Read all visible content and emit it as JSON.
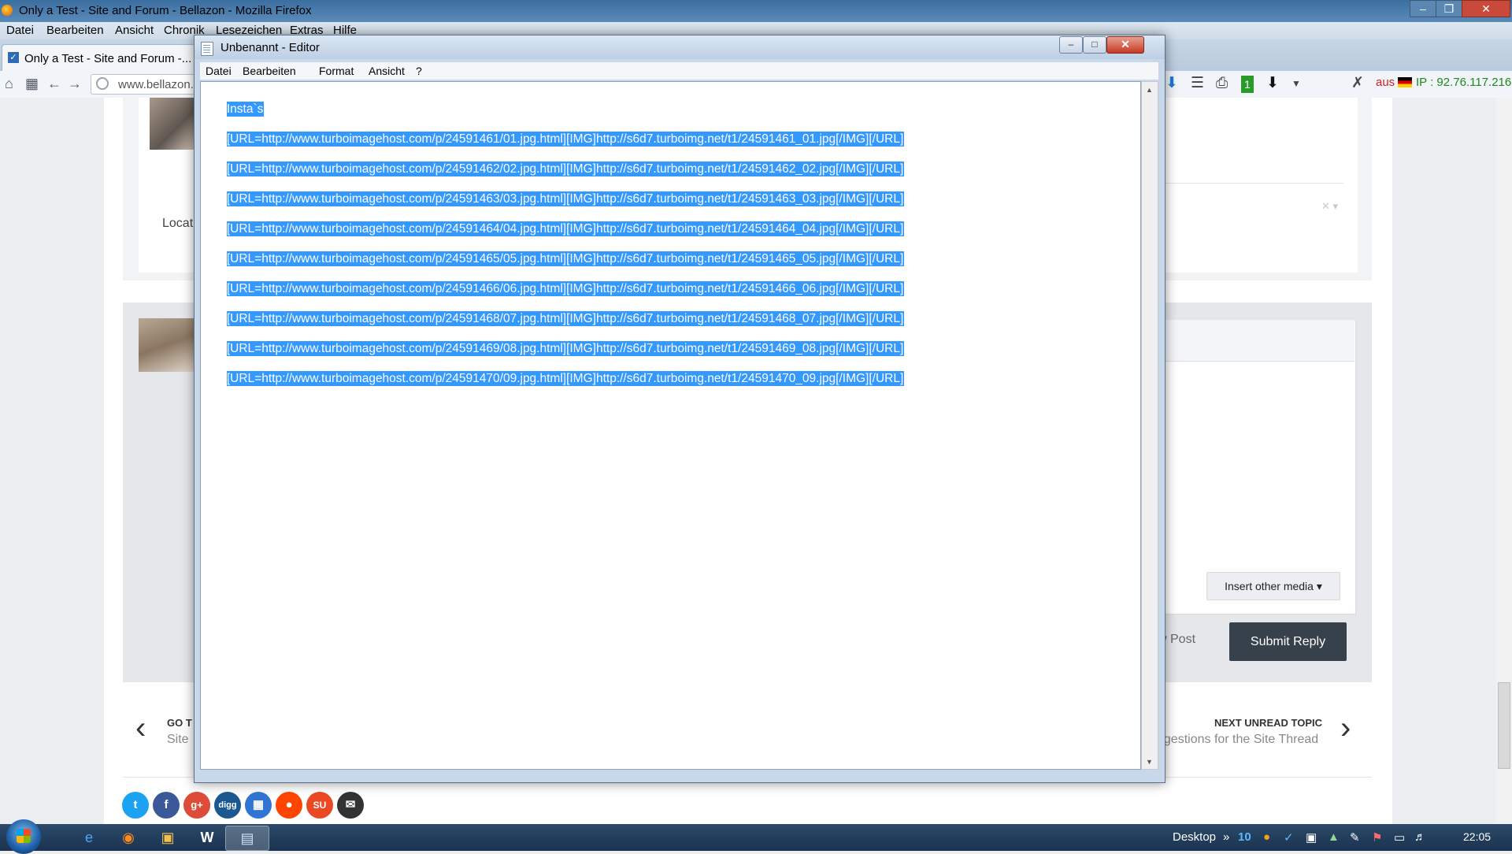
{
  "firefox": {
    "window_title": "Only a Test - Site and Forum - Bellazon - Mozilla Firefox",
    "menu": [
      "Datei",
      "Bearbeiten",
      "Ansicht",
      "Chronik",
      "Lesezeichen",
      "Extras",
      "Hilfe"
    ],
    "tab_label": "Only a Test - Site and Forum -...",
    "url": "www.bellazon.",
    "addon_aus": "aus",
    "ip_label": "IP : 92.76.117.216"
  },
  "page": {
    "post_location_fragment": "Locat",
    "insert_other_media": "Insert other media ▾",
    "preview_post_fragment": "w Post",
    "submit_reply": "Submit Reply",
    "go_to_label": "GO T",
    "go_to_sub": "Site",
    "next_unread_label": "NEXT UNREAD TOPIC",
    "next_unread_sub": "ggestions for the Site Thread",
    "share_icons": [
      "twitter-icon",
      "facebook-icon",
      "google-plus-icon",
      "digg-icon",
      "delicious-icon",
      "reddit-icon",
      "stumbleupon-icon",
      "email-icon"
    ]
  },
  "notepad": {
    "title": "Unbenannt - Editor",
    "menu": [
      "Datei",
      "Bearbeiten",
      "Format",
      "Ansicht",
      "?"
    ],
    "lines": [
      "Insta`s",
      "[URL=http://www.turboimagehost.com/p/24591461/01.jpg.html][IMG]http://s6d7.turboimg.net/t1/24591461_01.jpg[/IMG][/URL]",
      "[URL=http://www.turboimagehost.com/p/24591462/02.jpg.html][IMG]http://s6d7.turboimg.net/t1/24591462_02.jpg[/IMG][/URL]",
      "[URL=http://www.turboimagehost.com/p/24591463/03.jpg.html][IMG]http://s6d7.turboimg.net/t1/24591463_03.jpg[/IMG][/URL]",
      "[URL=http://www.turboimagehost.com/p/24591464/04.jpg.html][IMG]http://s6d7.turboimg.net/t1/24591464_04.jpg[/IMG][/URL]",
      "[URL=http://www.turboimagehost.com/p/24591465/05.jpg.html][IMG]http://s6d7.turboimg.net/t1/24591465_05.jpg[/IMG][/URL]",
      "[URL=http://www.turboimagehost.com/p/24591466/06.jpg.html][IMG]http://s6d7.turboimg.net/t1/24591466_06.jpg[/IMG][/URL]",
      "[URL=http://www.turboimagehost.com/p/24591468/07.jpg.html][IMG]http://s6d7.turboimg.net/t1/24591468_07.jpg[/IMG][/URL]",
      "[URL=http://www.turboimagehost.com/p/24591469/08.jpg.html][IMG]http://s6d7.turboimg.net/t1/24591469_08.jpg[/IMG][/URL]",
      "[URL=http://www.turboimagehost.com/p/24591470/09.jpg.html][IMG]http://s6d7.turboimg.net/t1/24591470_09.jpg[/IMG][/URL]"
    ],
    "selection_color": "#3399ff"
  },
  "taskbar": {
    "desktop_label": "Desktop",
    "tray_badge": "10",
    "clock": "22:05"
  }
}
